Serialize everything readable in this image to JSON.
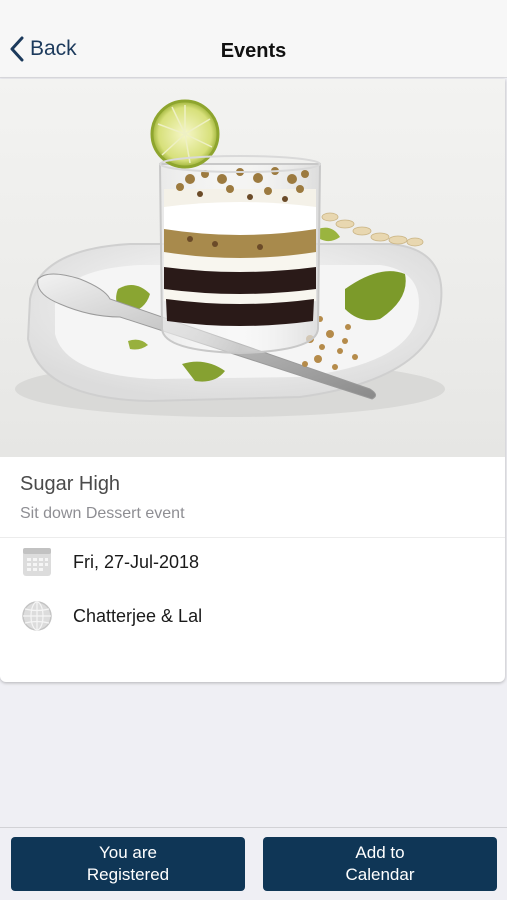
{
  "nav": {
    "back_label": "Back",
    "title": "Events"
  },
  "event": {
    "image_icon": "dessert-photo",
    "title": "Sugar High",
    "subtitle": "Sit down Dessert event",
    "date": "Fri, 27-Jul-2018",
    "date_icon": "calendar-icon",
    "venue": "Chatterjee & Lal",
    "venue_icon": "globe-icon"
  },
  "actions": {
    "registered_line1": "You are",
    "registered_line2": "Registered",
    "calendar_line1": "Add to",
    "calendar_line2": "Calendar"
  },
  "colors": {
    "accent": "#0f3656",
    "nav_tint": "#1c3a5c"
  }
}
